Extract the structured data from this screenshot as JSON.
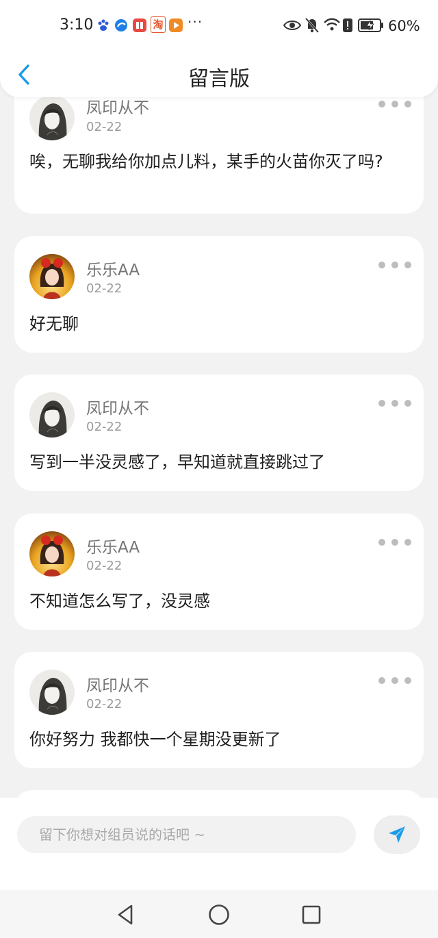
{
  "status_bar": {
    "time": "3:10",
    "overflow": "···",
    "battery": "60%",
    "app_icons": [
      "baidu-icon",
      "browser-icon",
      "reader-icon",
      "taobao-icon",
      "video-icon"
    ],
    "taobao_glyph": "淘",
    "system_icons": [
      "eye-icon",
      "mute-icon",
      "wifi-icon",
      "alert-icon",
      "battery-icon"
    ]
  },
  "header": {
    "title": "留言版"
  },
  "messages": [
    {
      "user": "凤印从不",
      "date": "02-22",
      "text": "唉，无聊我给你加点儿料，某手的火苗你灭了吗?"
    },
    {
      "user": "乐乐AA",
      "date": "02-22",
      "text": "好无聊"
    },
    {
      "user": "凤印从不",
      "date": "02-22",
      "text": "写到一半没灵感了，早知道就直接跳过了"
    },
    {
      "user": "乐乐AA",
      "date": "02-22",
      "text": "不知道怎么写了，没灵感"
    },
    {
      "user": "凤印从不",
      "date": "02-22",
      "text": "你好努力 我都快一个星期没更新了"
    }
  ],
  "composer": {
    "placeholder": "留下你想对组员说的话吧 ~",
    "value": ""
  },
  "colors": {
    "accent": "#1a9be8",
    "background": "#f2f2f2",
    "card": "#ffffff"
  }
}
